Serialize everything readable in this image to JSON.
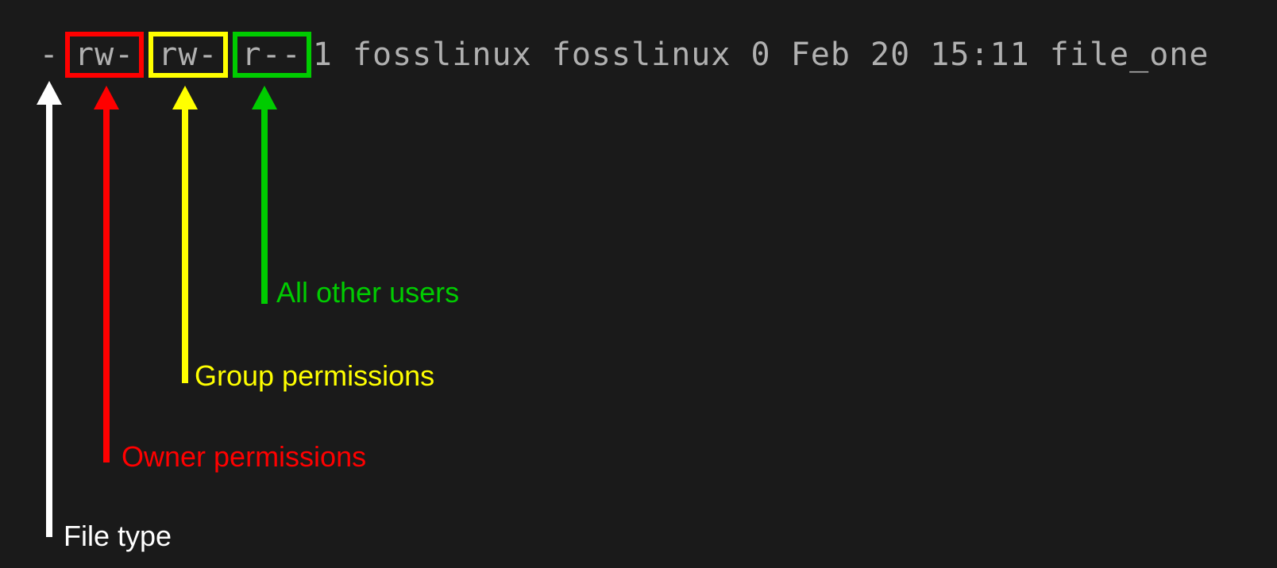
{
  "terminal": {
    "file_type": "-",
    "owner_perms": "rw-",
    "group_perms": "rw-",
    "other_perms": "r--",
    "rest": " 1 fosslinux fosslinux 0 Feb 20 15:11 file_one"
  },
  "labels": {
    "file_type": "File type",
    "owner": "Owner permissions",
    "group": "Group permissions",
    "other": "All other users"
  },
  "colors": {
    "white": "#ffffff",
    "red": "#ff0000",
    "yellow": "#ffff00",
    "green": "#00cc00",
    "bg": "#1a1a1a",
    "text": "#b0b0b0"
  }
}
